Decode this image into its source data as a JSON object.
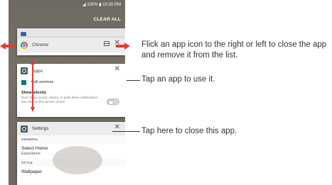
{
  "status_bar": {
    "text": "◢ 100% ▮ 10:20 PM"
  },
  "recents": {
    "clear_all": "CLEAR ALL"
  },
  "cards": {
    "chrome": {
      "title": "Chrome"
    },
    "apps": {
      "title": "Apps",
      "row_label": "Call services",
      "setting_title": "Show silently",
      "setting_desc": "Don't make sound, vibrate, or peek these notifications into view on the current screen."
    },
    "settings": {
      "title": "Settings",
      "section_general": "GENERAL",
      "item_title": "Select Home",
      "item_sub": "EasyHome",
      "section_style": "STYLE",
      "next_item": "Wallpaper"
    }
  },
  "callouts": {
    "flick": "Flick an app icon to the right or left to close the app and remove it from the list.",
    "tap_app": "Tap an app to use it.",
    "tap_close": "Tap here to close this app."
  },
  "colors": {
    "arrow": "#e53935",
    "phone_bg": "#737066"
  }
}
